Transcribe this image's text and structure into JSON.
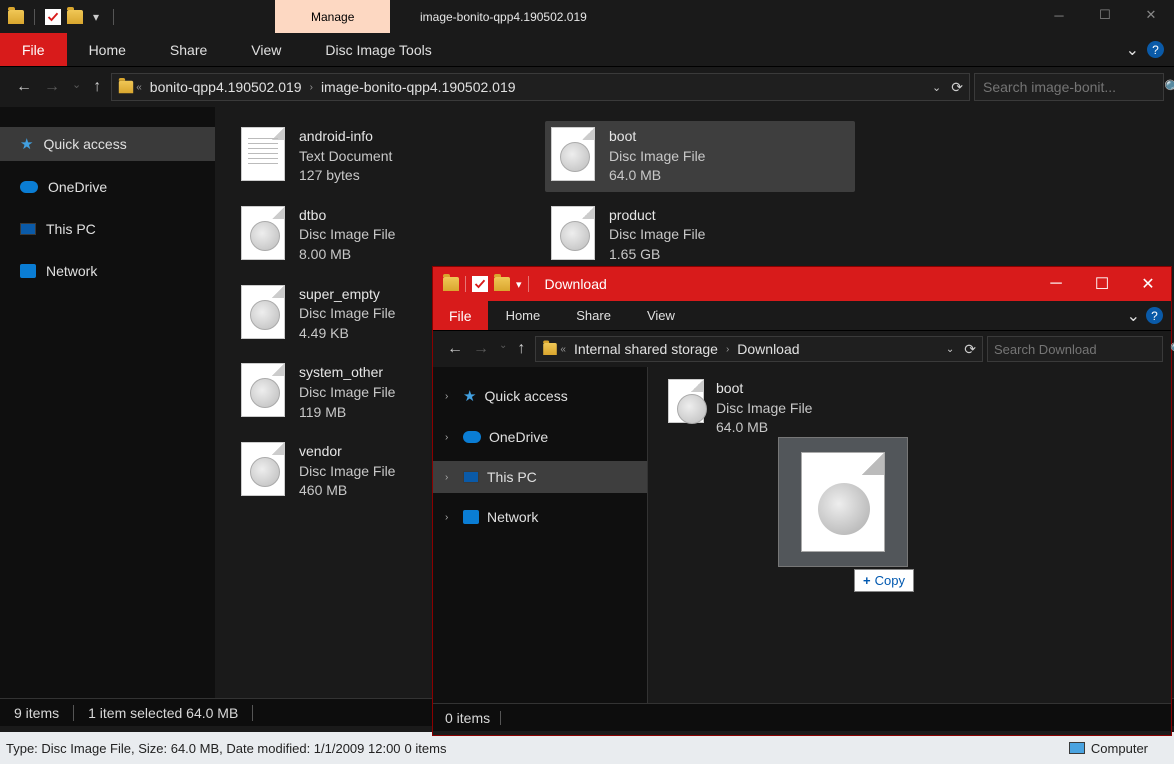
{
  "win1": {
    "manage_tab": "Manage",
    "title": "image-bonito-qpp4.190502.019",
    "ribbon": {
      "file": "File",
      "home": "Home",
      "share": "Share",
      "view": "View",
      "subtab": "Disc Image Tools"
    },
    "breadcrumb": [
      "bonito-qpp4.190502.019",
      "image-bonito-qpp4.190502.019"
    ],
    "search_placeholder": "Search image-bonit...",
    "sidebar": {
      "quick_access": "Quick access",
      "onedrive": "OneDrive",
      "this_pc": "This PC",
      "network": "Network"
    },
    "files_col1": [
      {
        "name": "android-info",
        "type": "Text Document",
        "size": "127 bytes",
        "icon": "doc"
      },
      {
        "name": "dtbo",
        "type": "Disc Image File",
        "size": "8.00 MB",
        "icon": "disc"
      },
      {
        "name": "super_empty",
        "type": "Disc Image File",
        "size": "4.49 KB",
        "icon": "disc"
      },
      {
        "name": "system_other",
        "type": "Disc Image File",
        "size": "119 MB",
        "icon": "disc"
      },
      {
        "name": "vendor",
        "type": "Disc Image File",
        "size": "460 MB",
        "icon": "disc"
      }
    ],
    "files_col2": [
      {
        "name": "boot",
        "type": "Disc Image File",
        "size": "64.0 MB",
        "icon": "disc",
        "selected": true
      },
      {
        "name": "product",
        "type": "Disc Image File",
        "size": "1.65 GB",
        "icon": "disc"
      }
    ],
    "status": {
      "items": "9 items",
      "selected": "1 item selected  64.0 MB"
    },
    "bottombar_left": "Type: Disc Image File, Size: 64.0 MB, Date modified: 1/1/2009 12:00",
    "bottombar_items": "0 items",
    "bottombar_computer": "Computer"
  },
  "win2": {
    "title": "Download",
    "ribbon": {
      "file": "File",
      "home": "Home",
      "share": "Share",
      "view": "View"
    },
    "breadcrumb": [
      "Internal shared storage",
      "Download"
    ],
    "search_placeholder": "Search Download",
    "sidebar": {
      "quick_access": "Quick access",
      "onedrive": "OneDrive",
      "this_pc": "This PC",
      "network": "Network"
    },
    "file": {
      "name": "boot",
      "type": "Disc Image File",
      "size": "64.0 MB"
    },
    "copy_badge": "Copy",
    "status": "0 items"
  }
}
